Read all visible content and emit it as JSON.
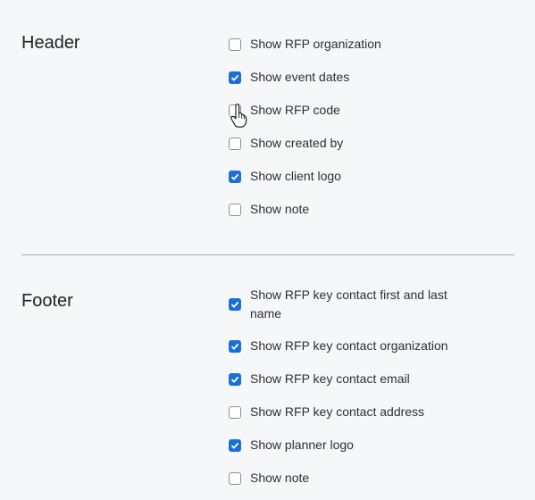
{
  "header": {
    "title": "Header",
    "options": [
      {
        "label": "Show RFP organization",
        "checked": false
      },
      {
        "label": "Show event dates",
        "checked": true
      },
      {
        "label": "Show RFP code",
        "checked": false
      },
      {
        "label": "Show created by",
        "checked": false
      },
      {
        "label": "Show client logo",
        "checked": true
      },
      {
        "label": "Show note",
        "checked": false
      }
    ]
  },
  "footer": {
    "title": "Footer",
    "options": [
      {
        "label": "Show RFP key contact first and last name",
        "checked": true
      },
      {
        "label": "Show RFP key contact organization",
        "checked": true
      },
      {
        "label": "Show RFP key contact email",
        "checked": true
      },
      {
        "label": "Show RFP key contact address",
        "checked": false
      },
      {
        "label": "Show planner logo",
        "checked": true
      },
      {
        "label": "Show note",
        "checked": false
      }
    ]
  },
  "colors": {
    "accent": "#1a6fd8",
    "divider": "#a7abb2",
    "background": "#f6f7f9"
  },
  "icons": {
    "checkmark": "checkmark-icon",
    "cursor": "hand-pointer-cursor-icon"
  }
}
